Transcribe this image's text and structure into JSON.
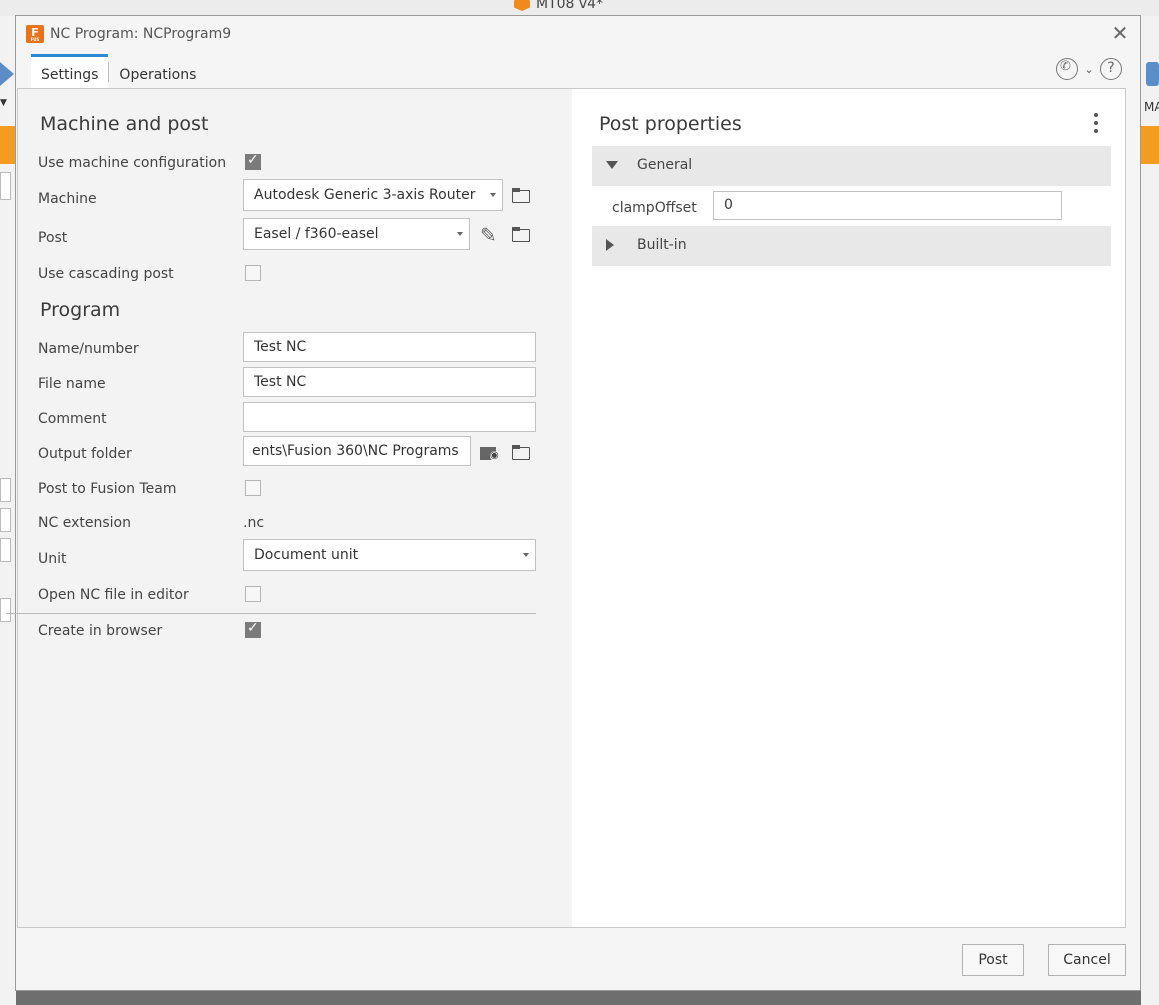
{
  "background": {
    "document_title": "MT08 v4*",
    "toolbar_text": "MA"
  },
  "dialog": {
    "app_icon_letter": "F",
    "app_icon_sub": "FUS",
    "title": "NC Program: NCProgram9",
    "tabs": [
      "Settings",
      "Operations"
    ],
    "active_tab": "Settings"
  },
  "machine_and_post": {
    "heading": "Machine and post",
    "use_machine_config_label": "Use machine configuration",
    "use_machine_config_checked": true,
    "machine_label": "Machine",
    "machine_value": "Autodesk Generic 3-axis Router",
    "post_label": "Post",
    "post_value": "Easel / f360-easel",
    "cascading_label": "Use cascading post",
    "cascading_checked": false
  },
  "program": {
    "heading": "Program",
    "name_label": "Name/number",
    "name_value": "Test NC",
    "filename_label": "File name",
    "filename_value": "Test NC",
    "comment_label": "Comment",
    "comment_value": "",
    "output_label": "Output folder",
    "output_value": "ents\\Fusion 360\\NC Programs",
    "fusion_team_label": "Post to Fusion Team",
    "fusion_team_checked": false,
    "ext_label": "NC extension",
    "ext_value": ".nc",
    "unit_label": "Unit",
    "unit_value": "Document unit",
    "open_editor_label": "Open NC file in editor",
    "open_editor_checked": false,
    "create_browser_label": "Create in browser",
    "create_browser_checked": true
  },
  "post_properties": {
    "heading": "Post properties",
    "groups": [
      {
        "label": "General",
        "expanded": true
      },
      {
        "label": "Built-in",
        "expanded": false
      }
    ],
    "clamp_label": "clampOffset",
    "clamp_value": "0"
  },
  "footer": {
    "post_label": "Post",
    "cancel_label": "Cancel"
  },
  "colors": {
    "accent": "#2a8ad4",
    "orange": "#f39c1f"
  }
}
